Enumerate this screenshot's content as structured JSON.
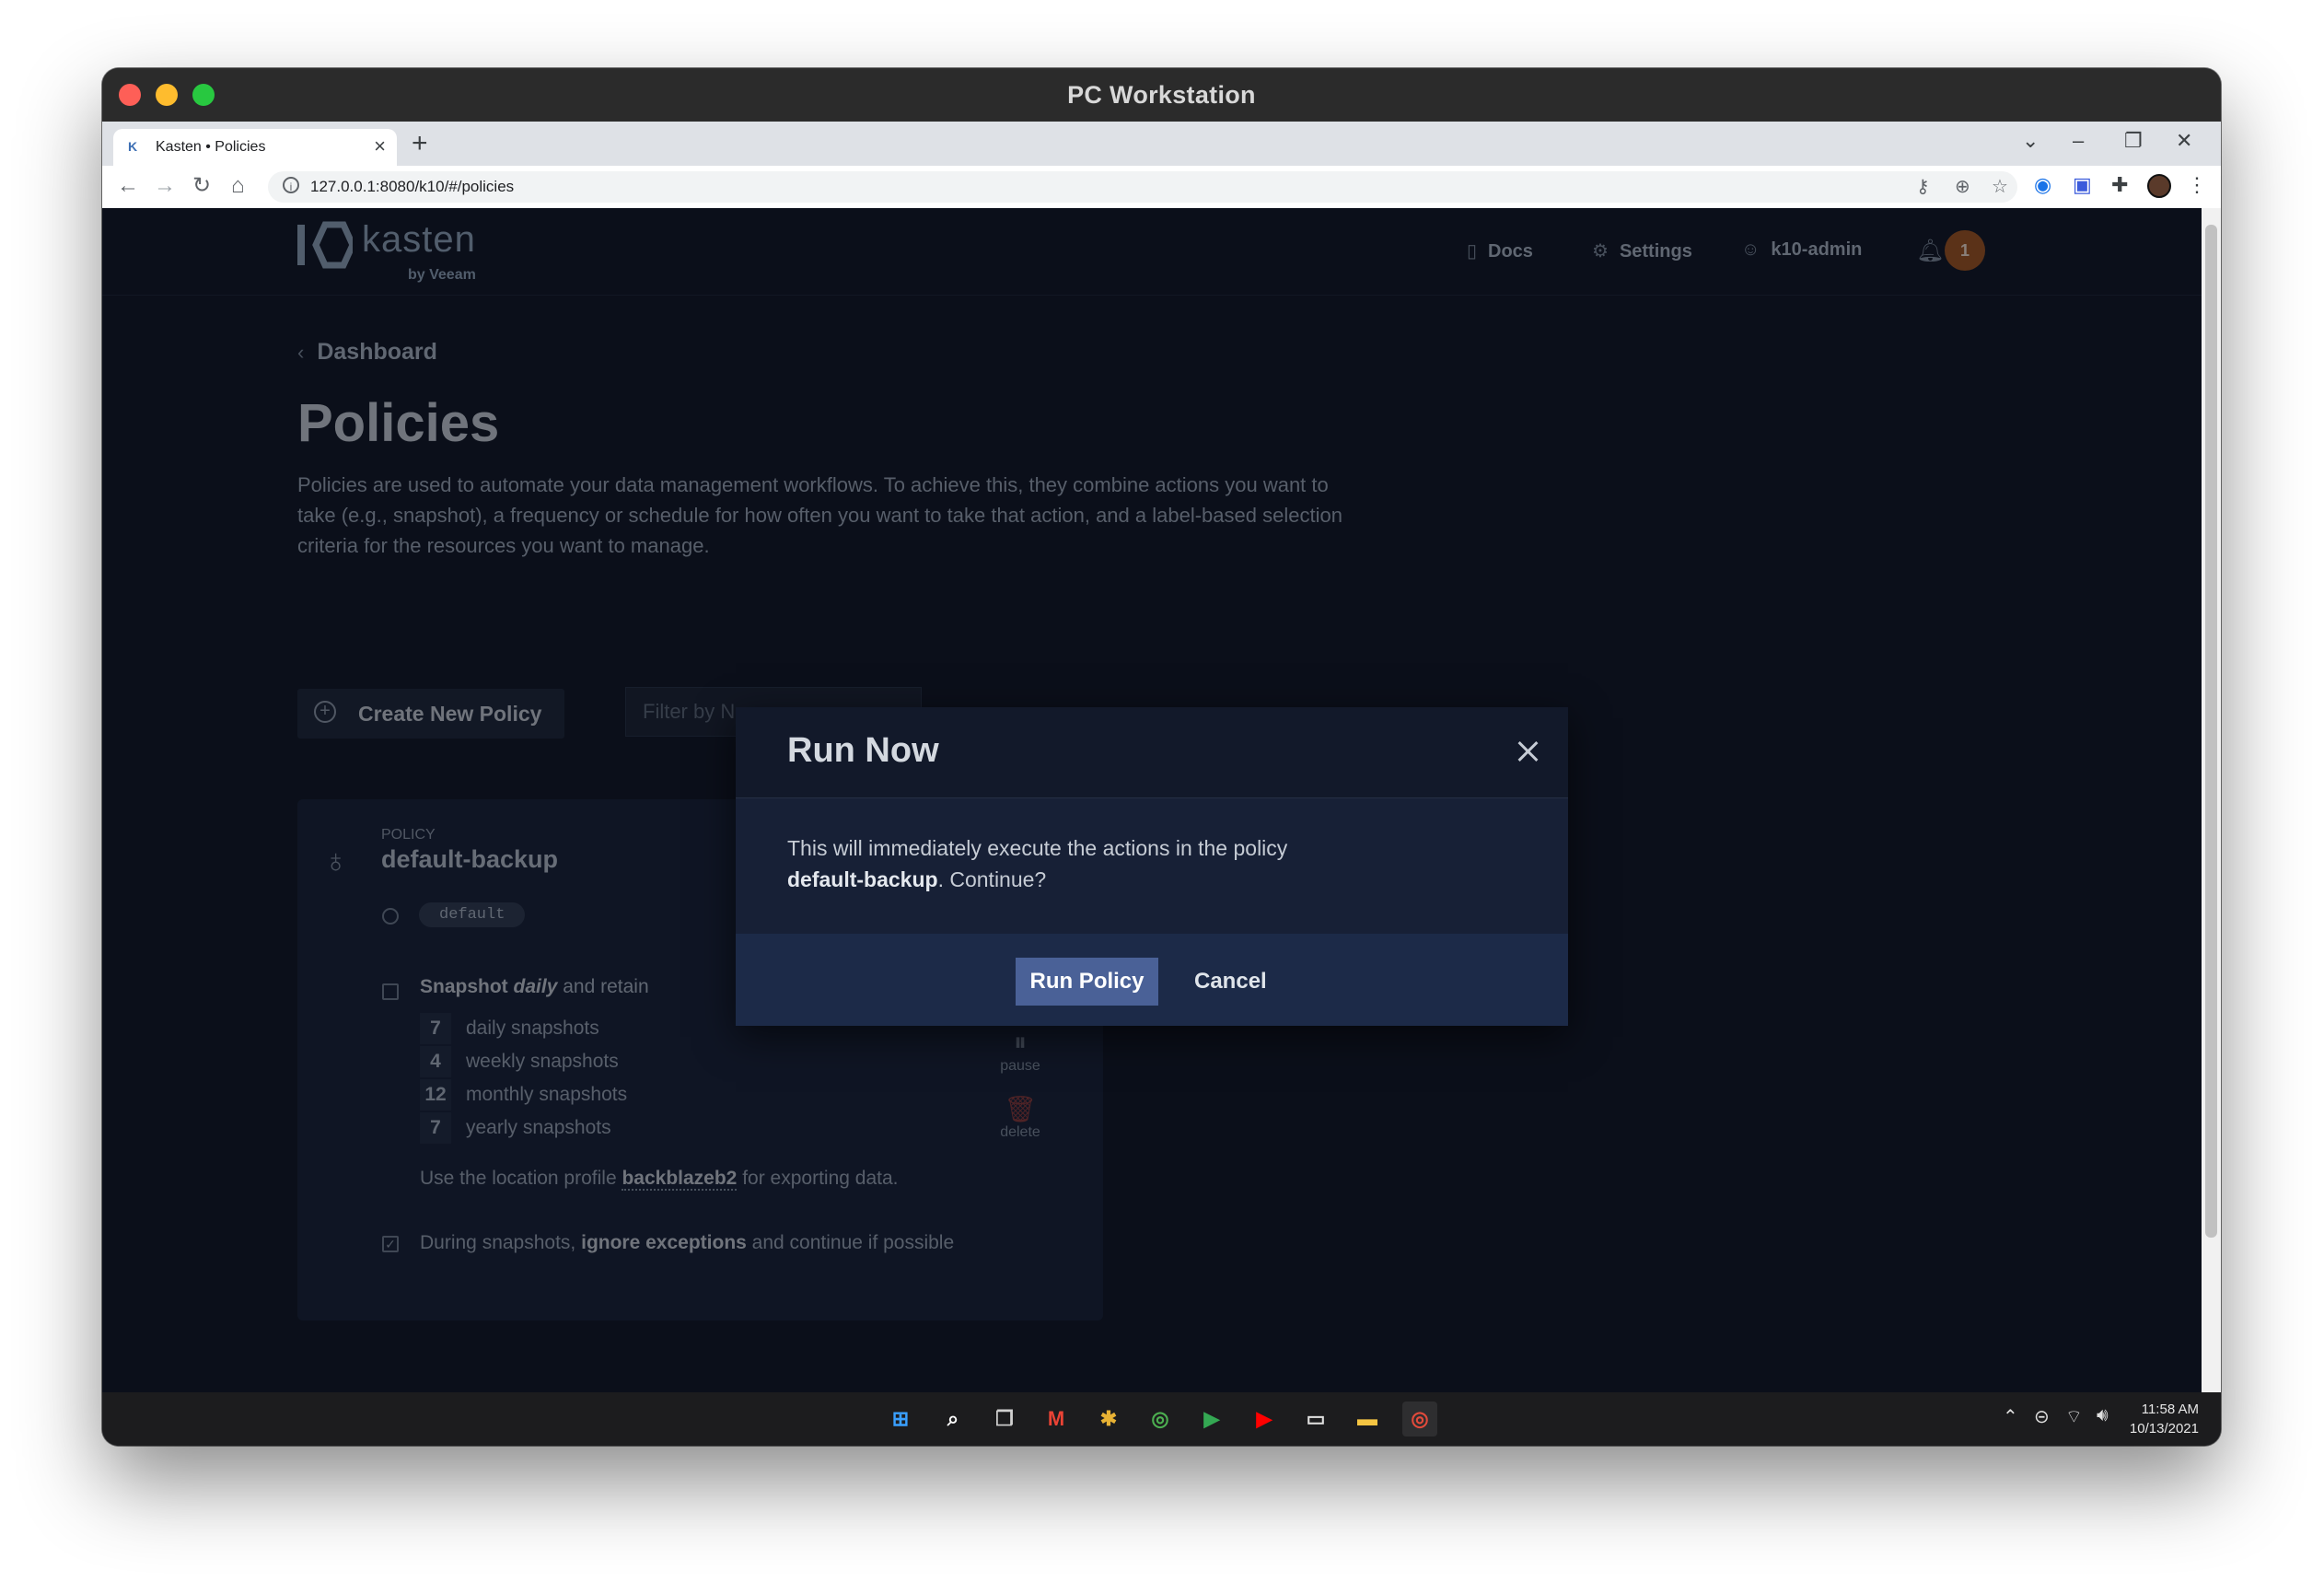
{
  "window": {
    "title": "PC Workstation"
  },
  "browser": {
    "tab_title": "Kasten • Policies",
    "tab_favicon": "K",
    "url": "127.0.0.1:8080/k10/#/policies"
  },
  "header": {
    "logo_text": "kasten",
    "logo_sub": "by Veeam",
    "docs": "Docs",
    "settings": "Settings",
    "user": "k10-admin",
    "notifications": "1"
  },
  "page": {
    "breadcrumb": "Dashboard",
    "title": "Policies",
    "description": "Policies are used to automate your data management workflows. To achieve this, they combine actions you want to take (e.g., snapshot), a frequency or schedule for how often you want to take that action, and a label-based selection criteria for the resources you want to manage.",
    "create_button": "Create New Policy",
    "filter_placeholder": "Filter by Name"
  },
  "policy": {
    "kicker": "POLICY",
    "name": "default-backup",
    "namespace": "default",
    "snapshot_prefix": "Snapshot",
    "frequency": "daily",
    "snapshot_suffix": "and retain",
    "retention": [
      {
        "count": "7",
        "label": "daily snapshots"
      },
      {
        "count": "4",
        "label": "weekly snapshots"
      },
      {
        "count": "12",
        "label": "monthly snapshots"
      },
      {
        "count": "7",
        "label": "yearly snapshots"
      }
    ],
    "location_prefix": "Use the location profile",
    "location_profile": "backblazeb2",
    "location_suffix": "for exporting data.",
    "exc_prefix": "During snapshots,",
    "exc_bold": "ignore exceptions",
    "exc_suffix": "and continue if possible",
    "pause_label": "pause",
    "delete_label": "delete"
  },
  "modal": {
    "title": "Run Now",
    "body_prefix": "This will immediately execute the actions in the policy",
    "policy_name": "default-backup",
    "body_suffix": ". Continue?",
    "run_button": "Run Policy",
    "cancel_button": "Cancel"
  },
  "taskbar": {
    "time": "11:58 AM",
    "date": "10/13/2021"
  }
}
